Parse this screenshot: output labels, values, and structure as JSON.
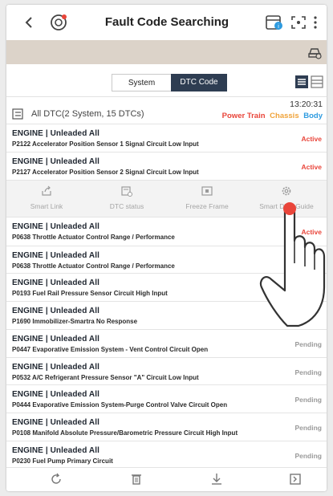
{
  "header": {
    "title": "Fault Code Searching",
    "back_icon": "chevron-left-icon",
    "left_icon": "engine-icon",
    "right_icons": [
      "calendar-icon",
      "fullscreen-icon",
      "more-icon"
    ]
  },
  "banner": {
    "icon": "car-icon"
  },
  "tabs": {
    "system_label": "System",
    "dtc_label": "DTC Code",
    "selected": "DTC Code"
  },
  "summary": {
    "count_text": "All DTC(2 System, 15 DTCs)",
    "time": "13:20:31",
    "filters": [
      {
        "label": "Power Train",
        "color": "#e9453a"
      },
      {
        "label": "Chassis",
        "color": "#f0a33a"
      },
      {
        "label": "Body",
        "color": "#2e9be0"
      }
    ]
  },
  "dtcs": [
    {
      "system": "ENGINE | Unleaded All",
      "description": "P2122 Accelerator Position Sensor 1 Signal Circuit Low Input",
      "status": "Active"
    },
    {
      "system": "ENGINE | Unleaded All",
      "description": "P2127 Accelerator Position Sensor 2 Signal Circuit Low Input",
      "status": "Active"
    },
    {
      "system": "ENGINE | Unleaded All",
      "description": "P0638 Throttle Actuator Control Range / Performance",
      "status": "Active"
    },
    {
      "system": "ENGINE | Unleaded All",
      "description": "P0638 Throttle Actuator Control Range / Performance",
      "status": ""
    },
    {
      "system": "ENGINE | Unleaded All",
      "description": "P0193 Fuel Rail Pressure Sensor Circuit High Input",
      "status": ""
    },
    {
      "system": "ENGINE | Unleaded All",
      "description": "P1690 Immobilizer-Smartra No Response",
      "status": ""
    },
    {
      "system": "ENGINE | Unleaded All",
      "description": "P0447 Evaporative Emission System - Vent Control Circuit Open",
      "status": "Pending"
    },
    {
      "system": "ENGINE | Unleaded All",
      "description": "P0532 A/C Refrigerant Pressure Sensor \"A\" Circuit Low Input",
      "status": "Pending"
    },
    {
      "system": "ENGINE | Unleaded All",
      "description": "P0444 Evaporative Emission System-Purge Control Valve Circuit Open",
      "status": "Pending"
    },
    {
      "system": "ENGINE | Unleaded All",
      "description": "P0108 Manifold Absolute Pressure/Barometric Pressure Circuit High Input",
      "status": "Pending"
    },
    {
      "system": "ENGINE | Unleaded All",
      "description": "P0230 Fuel Pump Primary Circuit",
      "status": "Pending"
    }
  ],
  "actions": [
    {
      "label": "Smart Link",
      "icon": "share-icon"
    },
    {
      "label": "DTC status",
      "icon": "dtc-status-icon"
    },
    {
      "label": "Freeze Frame",
      "icon": "freeze-frame-icon"
    },
    {
      "label": "Smart DTC Guide",
      "icon": "gear-icon"
    }
  ],
  "bottom_bar": {
    "icons": [
      "refresh-icon",
      "delete-icon",
      "download-icon",
      "export-icon"
    ]
  },
  "colors": {
    "accent_dark": "#2e3d52",
    "banner": "#dcd3c9",
    "active": "#e9453a",
    "pending": "#9a9a9a"
  }
}
